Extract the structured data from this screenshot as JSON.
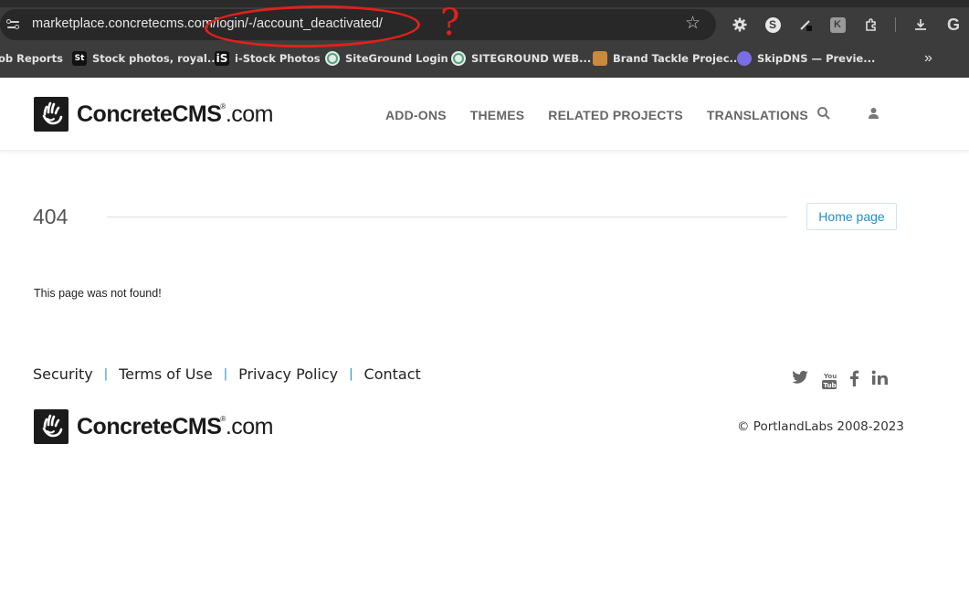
{
  "browser": {
    "url": "marketplace.concretecms.com/login/-/account_deactivated/",
    "annotation_mark": "?",
    "bookmarks": [
      {
        "label": "ob Reports",
        "icon": "none"
      },
      {
        "label": "Stock photos, royal...",
        "icon": "St"
      },
      {
        "label": "i-Stock Photos",
        "icon": "iS"
      },
      {
        "label": "SiteGround Login",
        "icon": "siteground-icon"
      },
      {
        "label": "SITEGROUND WEB...",
        "icon": "siteground-icon"
      },
      {
        "label": "Brand Tackle Projec...",
        "icon": "brand-tackle-icon"
      },
      {
        "label": "SkipDNS — Previe...",
        "icon": "skipdns-icon"
      }
    ],
    "bookmarks_more": "»",
    "extension_s": "S",
    "extension_k": "K"
  },
  "site": {
    "logo_bold": "ConcreteCMS",
    "logo_reg": "®",
    "logo_suffix": ".com",
    "nav": [
      "ADD-ONS",
      "THEMES",
      "RELATED PROJECTS",
      "TRANSLATIONS"
    ]
  },
  "main": {
    "code": "404",
    "home_button": "Home page",
    "message": "This page was not found!"
  },
  "footer": {
    "links": [
      "Security",
      "Terms of Use",
      "Privacy Policy",
      "Contact"
    ],
    "separator": "|",
    "social": [
      "twitter-icon",
      "youtube-icon",
      "facebook-icon",
      "linkedin-icon"
    ],
    "copyright": "© PortlandLabs 2008-2023"
  }
}
